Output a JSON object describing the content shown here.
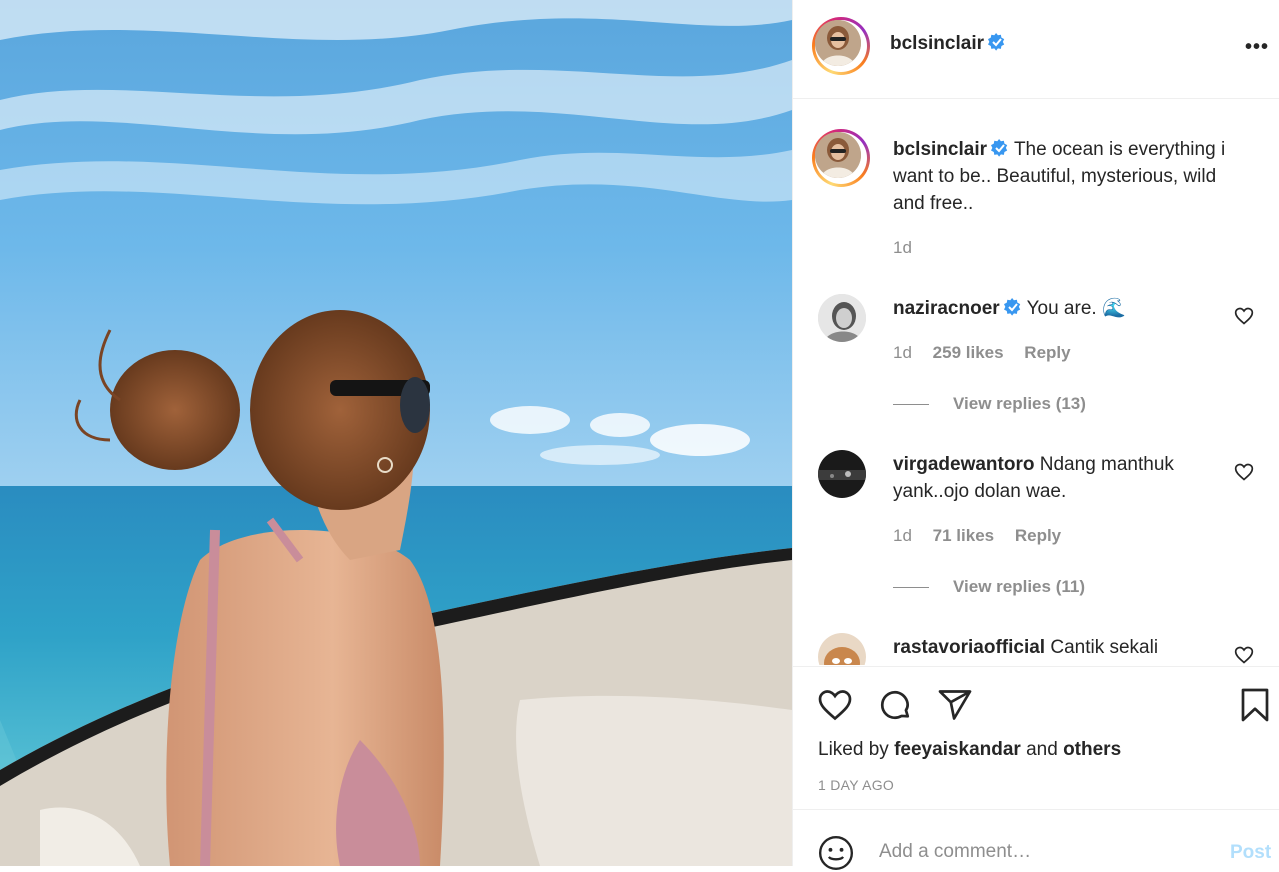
{
  "post": {
    "username": "bclsinclair",
    "more_label": "•••"
  },
  "caption": {
    "username": "bclsinclair",
    "text": "The ocean is everything i want to be.. Beautiful, mysterious, wild and free..",
    "time": "1d"
  },
  "comments": [
    {
      "username": "naziracnoer",
      "verified": true,
      "text": "You are.",
      "emoji": "🌊",
      "time": "1d",
      "likes": "259 likes",
      "reply": "Reply",
      "view_replies": "View replies (13)"
    },
    {
      "username": "virgadewantoro",
      "verified": false,
      "text": "Ndang manthuk yank..ojo dolan wae.",
      "time": "1d",
      "likes": "71 likes",
      "reply": "Reply",
      "view_replies": "View replies (11)"
    },
    {
      "username": "rastavoriaofficial",
      "verified": false,
      "text": "Cantik sekali"
    }
  ],
  "likes": {
    "prefix": "Liked by",
    "user": "feeyaiskandar",
    "conj": "and",
    "others": "others"
  },
  "timestamp": "1 DAY AGO",
  "comment_input": {
    "placeholder": "Add a comment…",
    "post_label": "Post"
  },
  "colors": {
    "verified": "#3897f0",
    "post_disabled": "#b2dffc",
    "muted": "#8e8e8e"
  }
}
